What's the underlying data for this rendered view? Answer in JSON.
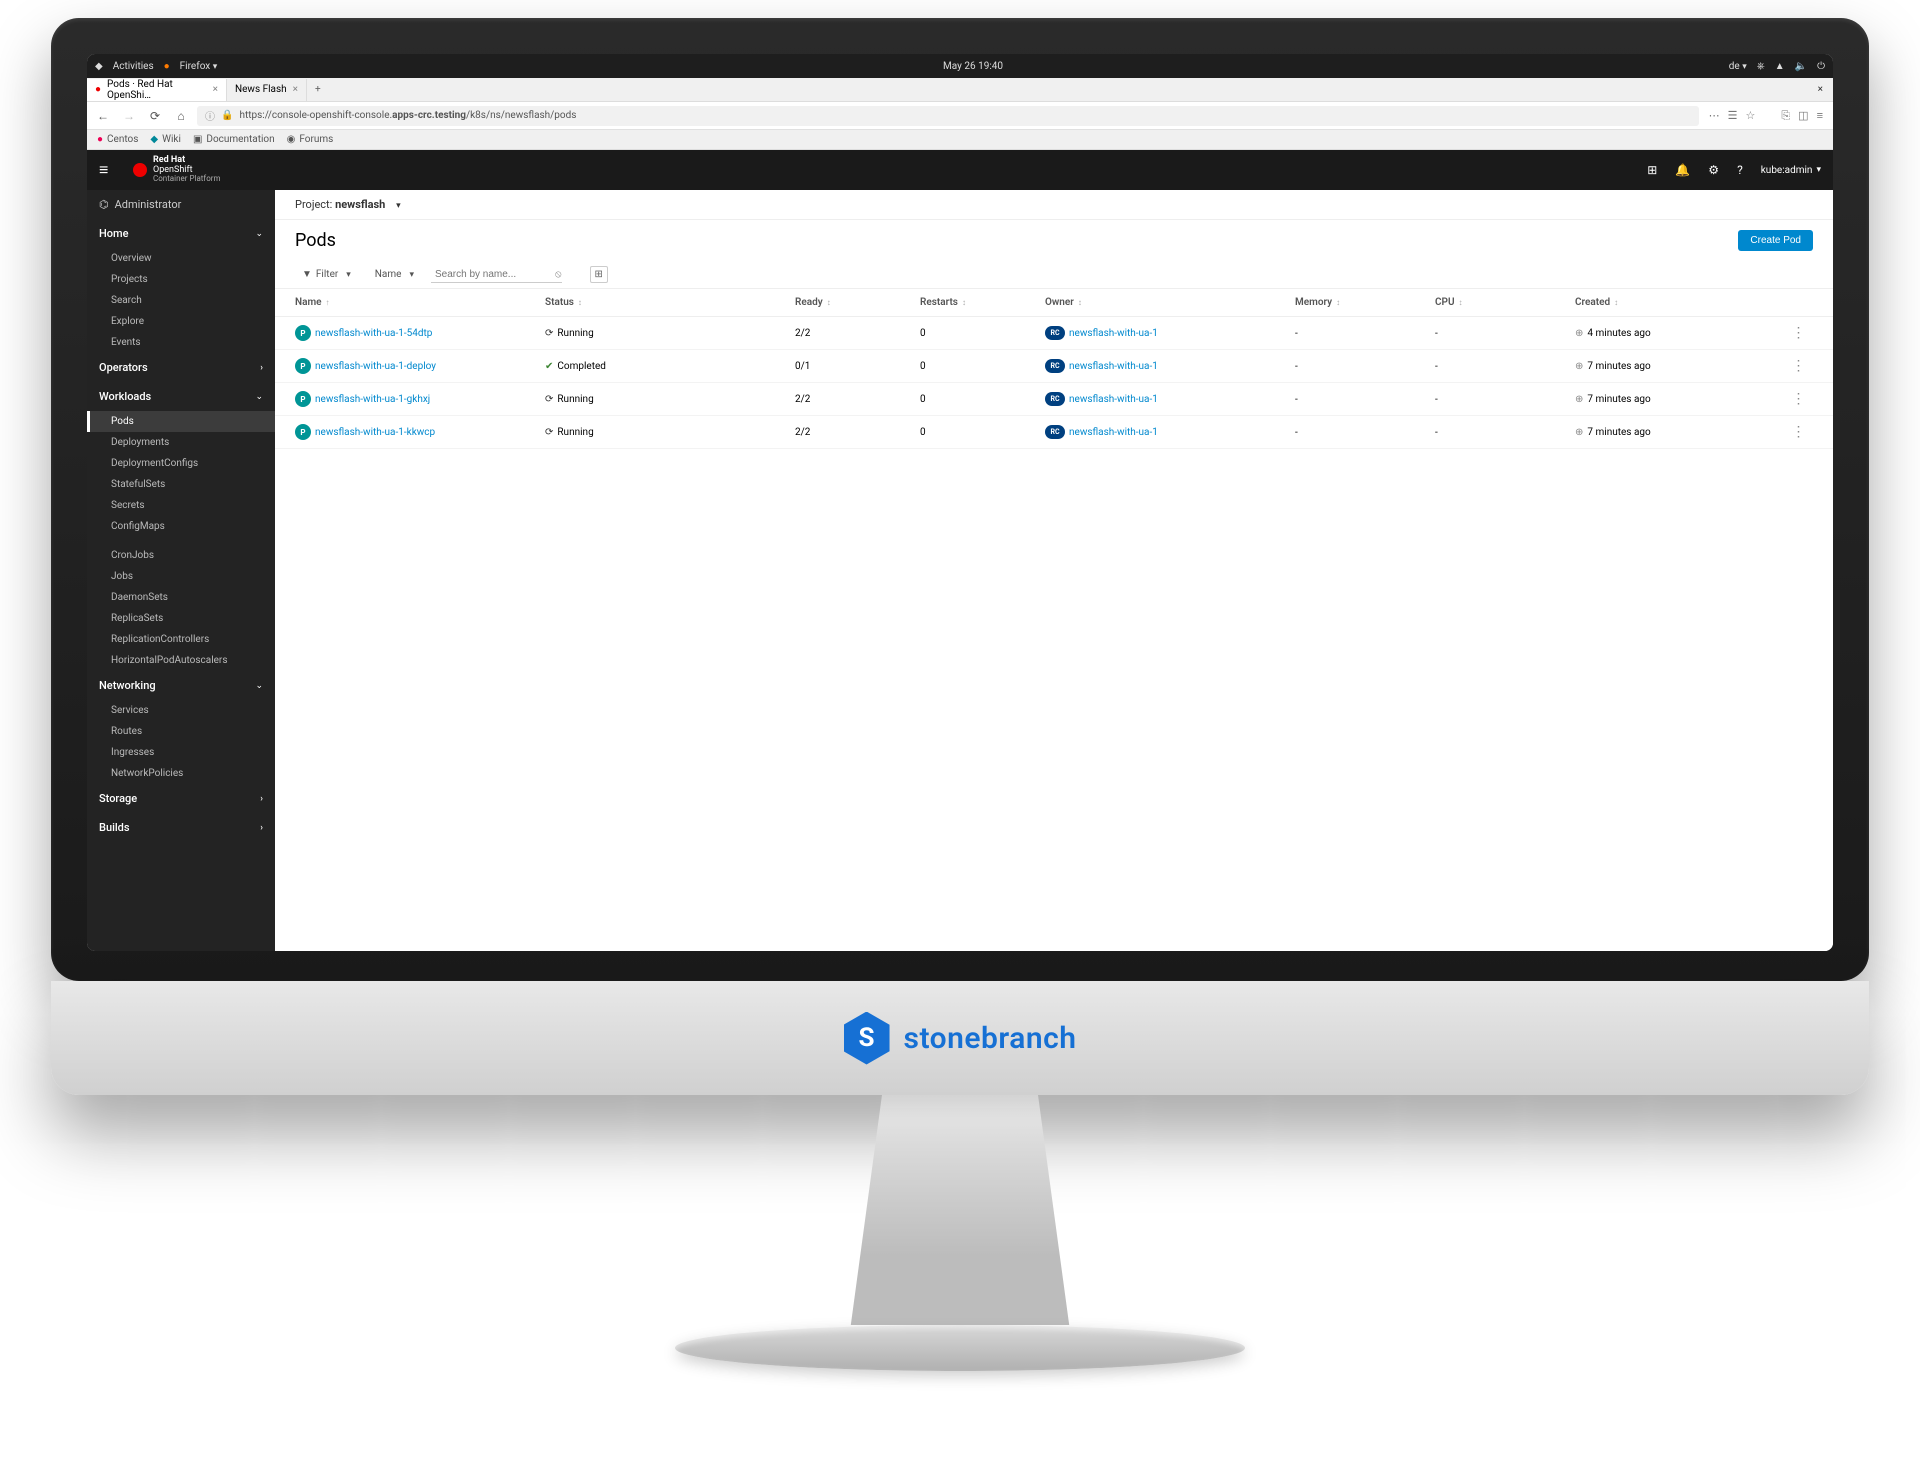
{
  "os": {
    "activities": "Activities",
    "browser": "Firefox",
    "datetime": "May 26 19:40",
    "lang": "de",
    "tray": [
      "⎈",
      "▲",
      "🔈",
      "⏻"
    ]
  },
  "browser": {
    "tabs": [
      {
        "title": "Pods · Red Hat OpenShi…",
        "active": true
      },
      {
        "title": "News Flash",
        "active": false
      }
    ],
    "url_prefix": "https://console-openshift-console.",
    "url_bold": "apps-crc.testing",
    "url_suffix": "/k8s/ns/newsflash/pods",
    "bookmarks": [
      {
        "icon": "●",
        "label": "Centos",
        "color": "#e05"
      },
      {
        "icon": "◆",
        "label": "Wiki",
        "color": "#089"
      },
      {
        "icon": "▣",
        "label": "Documentation",
        "color": "#888"
      },
      {
        "icon": "◉",
        "label": "Forums",
        "color": "#888"
      }
    ]
  },
  "header": {
    "brand_top": "Red Hat",
    "brand_mid": "OpenShift",
    "brand_bot": "Container Platform",
    "icons": [
      "⊞",
      "🔔",
      "⚙",
      "?"
    ],
    "user": "kube:admin"
  },
  "sidebar": {
    "perspective": "Administrator",
    "sections": [
      {
        "label": "Home",
        "open": true,
        "items": [
          "Overview",
          "Projects",
          "Search",
          "Explore",
          "Events"
        ]
      },
      {
        "label": "Operators",
        "open": false,
        "items": []
      },
      {
        "label": "Workloads",
        "open": true,
        "active": "Pods",
        "items": [
          "Pods",
          "Deployments",
          "DeploymentConfigs",
          "StatefulSets",
          "Secrets",
          "ConfigMaps",
          "",
          "CronJobs",
          "Jobs",
          "DaemonSets",
          "ReplicaSets",
          "ReplicationControllers",
          "HorizontalPodAutoscalers"
        ]
      },
      {
        "label": "Networking",
        "open": true,
        "items": [
          "Services",
          "Routes",
          "Ingresses",
          "NetworkPolicies"
        ]
      },
      {
        "label": "Storage",
        "open": false,
        "items": []
      },
      {
        "label": "Builds",
        "open": false,
        "items": []
      }
    ]
  },
  "project": {
    "label": "Project:",
    "name": "newsflash"
  },
  "page": {
    "title": "Pods",
    "create_button": "Create Pod",
    "filter_label": "Filter",
    "name_label": "Name",
    "search_placeholder": "Search by name..."
  },
  "table": {
    "columns": [
      "Name",
      "Status",
      "Ready",
      "Restarts",
      "Owner",
      "Memory",
      "CPU",
      "Created"
    ],
    "rows": [
      {
        "name": "newsflash-with-ua-1-54dtp",
        "status": "Running",
        "status_type": "running",
        "ready": "2/2",
        "restarts": "0",
        "owner": "newsflash-with-ua-1",
        "owner_badge": "RC",
        "memory": "-",
        "cpu": "-",
        "created": "4 minutes ago"
      },
      {
        "name": "newsflash-with-ua-1-deploy",
        "status": "Completed",
        "status_type": "completed",
        "ready": "0/1",
        "restarts": "0",
        "owner": "newsflash-with-ua-1",
        "owner_badge": "RC",
        "memory": "-",
        "cpu": "-",
        "created": "7 minutes ago"
      },
      {
        "name": "newsflash-with-ua-1-gkhxj",
        "status": "Running",
        "status_type": "running",
        "ready": "2/2",
        "restarts": "0",
        "owner": "newsflash-with-ua-1",
        "owner_badge": "RC",
        "memory": "-",
        "cpu": "-",
        "created": "7 minutes ago"
      },
      {
        "name": "newsflash-with-ua-1-kkwcp",
        "status": "Running",
        "status_type": "running",
        "ready": "2/2",
        "restarts": "0",
        "owner": "newsflash-with-ua-1",
        "owner_badge": "RC",
        "memory": "-",
        "cpu": "-",
        "created": "7 minutes ago"
      }
    ]
  },
  "monitor_brand": "stonebranch"
}
